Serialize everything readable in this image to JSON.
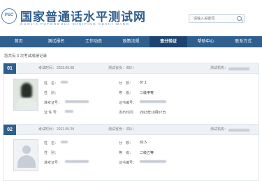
{
  "header": {
    "logo_text": "PSC",
    "title": "国家普通话水平测试网",
    "subtitle": "GUOJIA PUTONGHUA SHUIPING CESHI WANG",
    "search_placeholder": "请输入关键词"
  },
  "nav": {
    "items": [
      "首页",
      "测试报名",
      "工作动态",
      "政策法规",
      "查分验证",
      "帮助中心",
      "联系方式"
    ],
    "active_index": 4
  },
  "notice": "您共有 3 次考试成绩记录",
  "records": [
    {
      "number": "01",
      "exam_time_label": "考试时间：",
      "exam_time": "2023.09.08",
      "province_label": "测试省份：",
      "province": "四川",
      "org_label": "测试机构：",
      "name_label": "姓　名：",
      "gender_label": "性　别：",
      "ticket_label": "准考证号：",
      "id_label": "证 件 号：",
      "score_label": "分　数：",
      "score": "87.1",
      "level_label": "等　级：",
      "level": "二级甲等",
      "cert_label": "证书编号：",
      "issue_label": "发布时间：",
      "issue_date": "2023年10月07日"
    },
    {
      "number": "02",
      "exam_time_label": "考试时间：",
      "exam_time": "2021.05.29",
      "province_label": "测试省份：",
      "province": "四川",
      "org_label": "测试机构：",
      "name_label": "姓　名：",
      "gender_label": "性　别：",
      "ticket_label": "准考证号：",
      "score_label": "分　数：",
      "score": "82.5",
      "level_label": "等　级：",
      "level": "二级乙等",
      "cert_label": "证书编号："
    }
  ],
  "colors": {
    "brand": "#2f5f8f",
    "nav_active": "#1d4470",
    "record_header": "#eef2f7"
  }
}
